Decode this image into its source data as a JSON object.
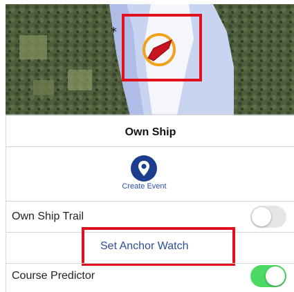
{
  "panel": {
    "title": "Own Ship",
    "create_event_label": "Create Event",
    "create_event_icon": "location-pin-icon"
  },
  "rows": {
    "own_ship_trail": {
      "label": "Own Ship Trail",
      "on": false
    },
    "anchor_watch": {
      "label": "Set Anchor Watch"
    },
    "course_predictor": {
      "label": "Course Predictor",
      "on": true
    }
  },
  "colors": {
    "accent_blue": "#1b3f8e",
    "toggle_on": "#4cd964",
    "toggle_off": "#e6e6e6",
    "highlight_red": "#e0101e",
    "vessel_red": "#c8141e",
    "vessel_ring": "#f0a21a"
  }
}
